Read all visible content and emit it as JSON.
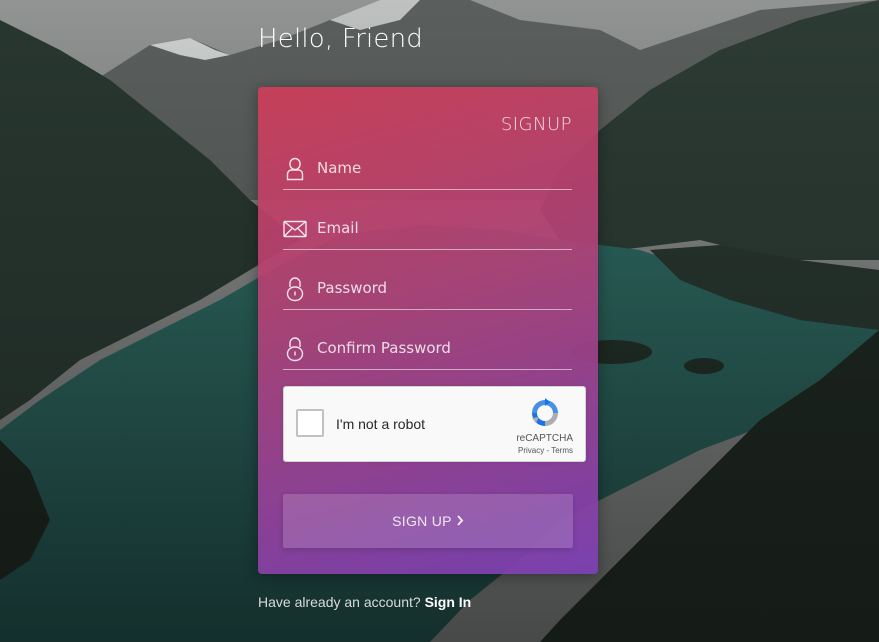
{
  "page": {
    "greeting": "Hello, Friend"
  },
  "signup_card": {
    "title": "SIGNUP",
    "fields": {
      "name": {
        "placeholder": "Name",
        "value": "",
        "icon": "user-icon"
      },
      "email": {
        "placeholder": "Email",
        "value": "",
        "icon": "envelope-icon"
      },
      "password": {
        "placeholder": "Password",
        "value": "",
        "icon": "lock-icon"
      },
      "confirm_password": {
        "placeholder": "Confirm Password",
        "value": "",
        "icon": "lock-icon"
      }
    },
    "captcha": {
      "label": "I'm not a robot",
      "brand": "reCAPTCHA",
      "privacy": "Privacy",
      "separator": " - ",
      "terms": "Terms",
      "checked": false,
      "icon": "recaptcha-logo"
    },
    "submit": {
      "label": "SIGN UP",
      "icon": "chevron-right-icon"
    }
  },
  "footer": {
    "text": "Have already an account? ",
    "link": "Sign In"
  },
  "colors": {
    "gradient_top": "#ce3e58",
    "gradient_bottom": "#7c40b6",
    "text": "#ffffff",
    "recaptcha_blue": "#4a90e2",
    "recaptcha_gray": "#abadb0"
  }
}
